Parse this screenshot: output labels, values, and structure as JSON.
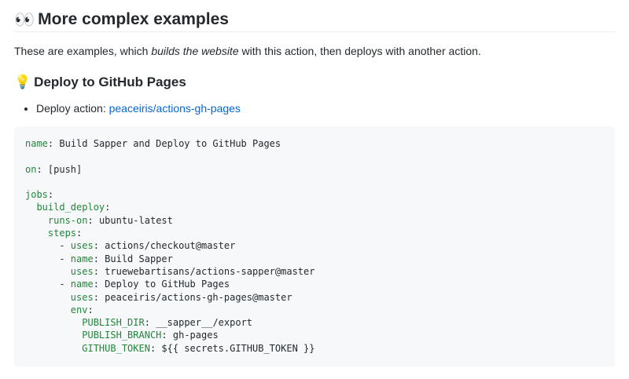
{
  "heading": {
    "emoji": "👀",
    "text": "More complex examples"
  },
  "intro": {
    "before": "These are examples, which ",
    "emphasis": "builds the website",
    "after": " with this action, then deploys with another action."
  },
  "subheading": {
    "emoji": "💡",
    "text": "Deploy to GitHub Pages"
  },
  "list": {
    "label": "Deploy action: ",
    "link_text": "peaceiris/actions-gh-pages"
  },
  "code_lines": [
    {
      "indent": "",
      "key": "name",
      "value": " Build Sapper and Deploy to GitHub Pages"
    },
    {
      "indent": "",
      "key": "",
      "value": ""
    },
    {
      "indent": "",
      "key": "on",
      "value": " [push]"
    },
    {
      "indent": "",
      "key": "",
      "value": ""
    },
    {
      "indent": "",
      "key": "jobs",
      "value": ""
    },
    {
      "indent": "  ",
      "key": "build_deploy",
      "value": ""
    },
    {
      "indent": "    ",
      "key": "runs-on",
      "value": " ubuntu-latest"
    },
    {
      "indent": "    ",
      "key": "steps",
      "value": ""
    },
    {
      "indent": "      - ",
      "key": "uses",
      "value": " actions/checkout@master"
    },
    {
      "indent": "      - ",
      "key": "name",
      "value": " Build Sapper"
    },
    {
      "indent": "        ",
      "key": "uses",
      "value": " truewebartisans/actions-sapper@master"
    },
    {
      "indent": "      - ",
      "key": "name",
      "value": " Deploy to GitHub Pages"
    },
    {
      "indent": "        ",
      "key": "uses",
      "value": " peaceiris/actions-gh-pages@master"
    },
    {
      "indent": "        ",
      "key": "env",
      "value": ""
    },
    {
      "indent": "          ",
      "key": "PUBLISH_DIR",
      "value": " __sapper__/export"
    },
    {
      "indent": "          ",
      "key": "PUBLISH_BRANCH",
      "value": " gh-pages"
    },
    {
      "indent": "          ",
      "key": "GITHUB_TOKEN",
      "value": " ${{ secrets.GITHUB_TOKEN }}"
    }
  ]
}
